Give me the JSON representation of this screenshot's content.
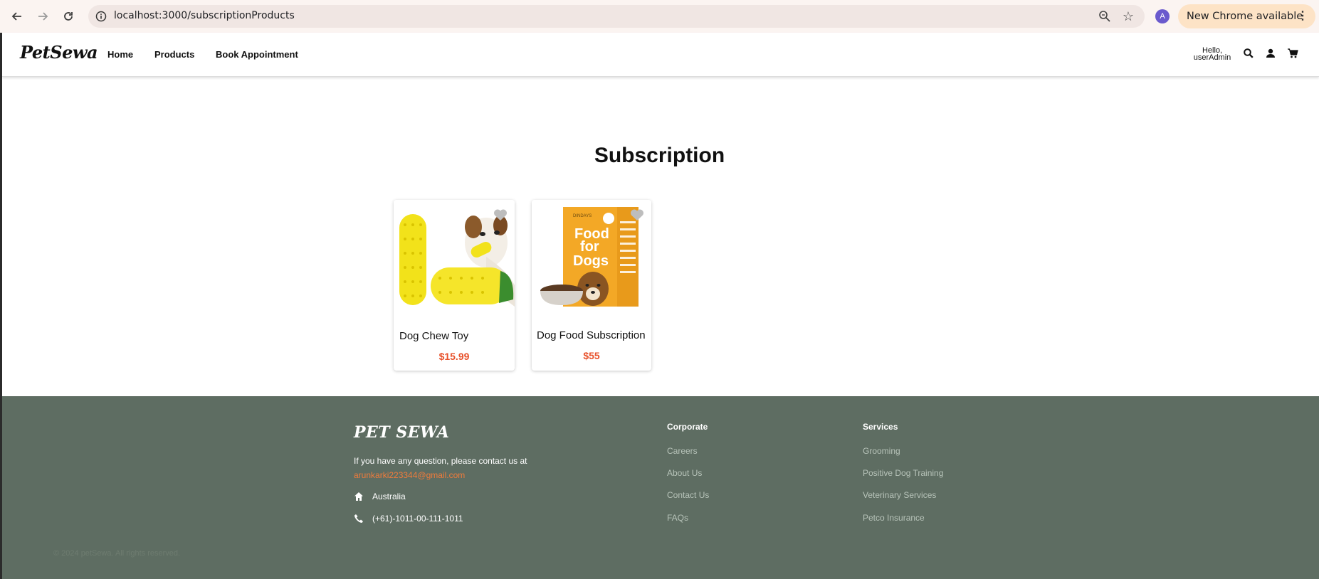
{
  "browser": {
    "url": "localhost:3000/subscriptionProducts",
    "profile_initial": "A",
    "update_label": "New Chrome available"
  },
  "header": {
    "logo": "PetSewa",
    "nav": [
      "Home",
      "Products",
      "Book Appointment"
    ],
    "greeting_line1": "Hello,",
    "greeting_line2": "userAdmin"
  },
  "main": {
    "title": "Subscription",
    "products": [
      {
        "name": "Dog Chew Toy",
        "price": "$15.99"
      },
      {
        "name": "Dog Food Subscription",
        "price": "$55"
      }
    ],
    "package_text": {
      "brand": "DINDAYS",
      "line1": "Food",
      "line2": "for",
      "line3": "Dogs"
    }
  },
  "footer": {
    "brand": "PET SEWA",
    "contact_text": "If you have any question, please contact us at",
    "email": "arunkarki223344@gmail.com",
    "location": "Australia",
    "phone": "(+61)-1011-00-111-1011",
    "corporate": {
      "heading": "Corporate",
      "links": [
        "Careers",
        "About Us",
        "Contact Us",
        "FAQs"
      ]
    },
    "services": {
      "heading": "Services",
      "links": [
        "Grooming",
        "Positive Dog Training",
        "Veterinary Services",
        "Petco Insurance"
      ]
    },
    "copyright": "© 2024 petSewa. All rights reserved."
  },
  "colors": {
    "accent_price": "#e8522c",
    "footer_bg": "#5e6d62",
    "email": "#f07b3b"
  }
}
